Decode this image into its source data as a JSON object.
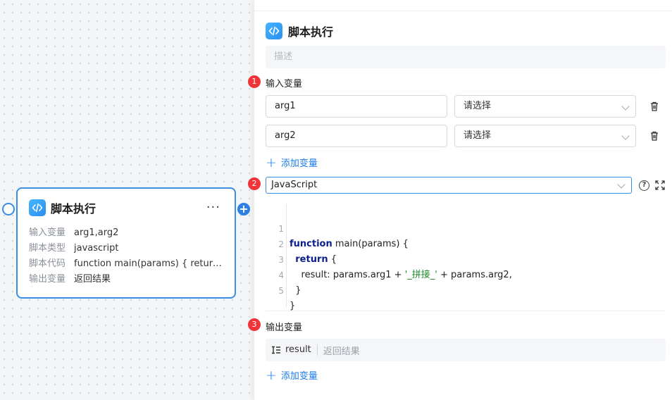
{
  "node": {
    "title": "脚本执行",
    "more": "···",
    "add_port": "+",
    "props": [
      {
        "key": "输入变量",
        "value": "arg1,arg2"
      },
      {
        "key": "脚本类型",
        "value": "javascript"
      },
      {
        "key": "脚本代码",
        "value": "function main(params) { return {..."
      },
      {
        "key": "输出变量",
        "value": "返回结果"
      }
    ]
  },
  "panel": {
    "title": "脚本执行",
    "description_placeholder": "描述",
    "steps": [
      "1",
      "2",
      "3"
    ],
    "inputs": {
      "label": "输入变量",
      "rows": [
        {
          "name": "arg1",
          "select": "请选择"
        },
        {
          "name": "arg2",
          "select": "请选择"
        }
      ],
      "add_label": "添加变量"
    },
    "language": {
      "selected": "JavaScript",
      "help": "?"
    },
    "code": {
      "lines": [
        {
          "num": "1",
          "segments": [
            {
              "t": "function",
              "c": "kw"
            },
            {
              "t": " main(params) {",
              "c": ""
            }
          ]
        },
        {
          "num": "2",
          "segments": [
            {
              "t": "  ",
              "c": ""
            },
            {
              "t": "return",
              "c": "kw"
            },
            {
              "t": " {",
              "c": ""
            }
          ]
        },
        {
          "num": "3",
          "segments": [
            {
              "t": "    result: params.arg1 + ",
              "c": ""
            },
            {
              "t": "'_拼接_'",
              "c": "str"
            },
            {
              "t": " + params.arg2,",
              "c": ""
            }
          ]
        },
        {
          "num": "4",
          "segments": [
            {
              "t": "  }",
              "c": ""
            }
          ]
        },
        {
          "num": "5",
          "segments": [
            {
              "t": "}",
              "c": ""
            }
          ]
        }
      ]
    },
    "outputs": {
      "label": "输出变量",
      "rows": [
        {
          "icon": "list-icon",
          "name": "result",
          "desc": "返回结果"
        }
      ],
      "add_label": "添加变量"
    }
  },
  "colors": {
    "accent": "#3a8ee6",
    "link": "#1e7ce8",
    "step_badge": "#f0353a",
    "keyword": "#0a1f8c",
    "string": "#1d8a2a"
  }
}
